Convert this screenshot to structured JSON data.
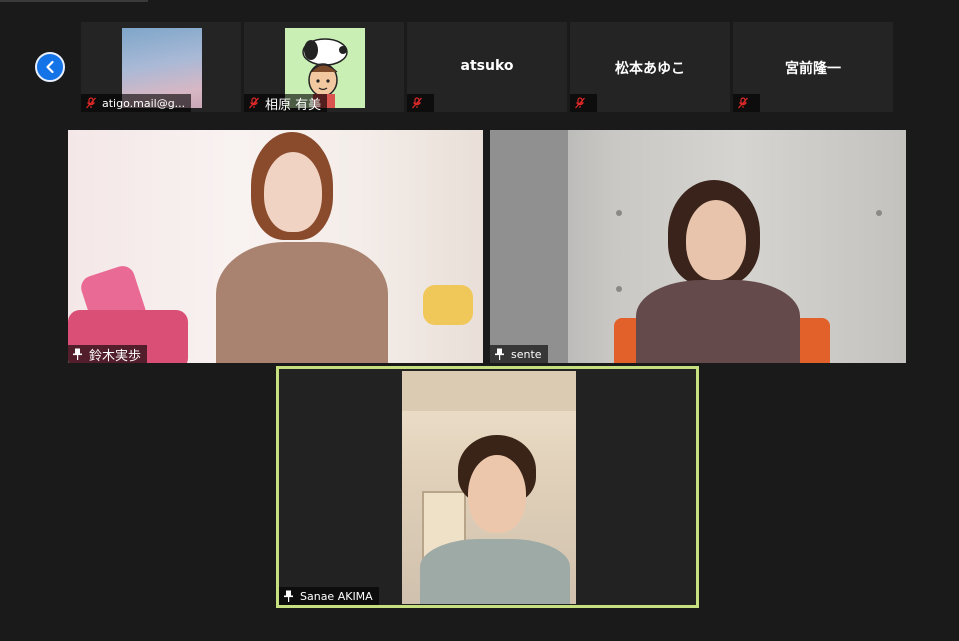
{
  "navigation": {
    "prev_icon": "chevron-left-icon"
  },
  "strip": [
    {
      "name": "atigo.mail@g...",
      "mode": "thumb",
      "thumb": "sky-photo",
      "muted": true
    },
    {
      "name": "相原 有美",
      "mode": "thumb",
      "thumb": "snoopy-avatar",
      "muted": true
    },
    {
      "name": "atsuko",
      "mode": "name",
      "muted": true
    },
    {
      "name": "松本あゆこ",
      "mode": "name",
      "muted": true
    },
    {
      "name": "宮前隆一",
      "mode": "name",
      "muted": true
    }
  ],
  "videos": [
    {
      "name": "鈴木実歩",
      "pinned": true
    },
    {
      "name": "sente",
      "pinned": true
    },
    {
      "name": "Sanae AKIMA",
      "pinned": true,
      "active_speaker": true
    }
  ],
  "colors": {
    "background": "#1a1a1a",
    "tile": "#242424",
    "accent": "#1473e6",
    "mute": "#e02828",
    "active_speaker_border": "#c6e07f"
  }
}
